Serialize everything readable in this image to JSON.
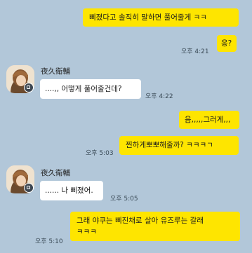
{
  "chat": {
    "messages": [
      {
        "id": "m1",
        "sender": "me",
        "text": "삐졌다고 솔직히 말하면 풀어줄게 ㅋㅋ",
        "time": ""
      },
      {
        "id": "m2",
        "sender": "me",
        "text": "응?",
        "time": "오후 4:21"
      },
      {
        "id": "m3",
        "sender": "other",
        "name": "夜久衛輔",
        "text": "....,, 어떻게 풀어줄건데?",
        "time": "오후 4:22"
      },
      {
        "id": "m4",
        "sender": "me",
        "text": "음,,,,,그러게,,,",
        "time": ""
      },
      {
        "id": "m5",
        "sender": "me",
        "text": "찐하게뽀뽀해줄까? ㅋㅋㅋㄱ",
        "time": "오후 5:03"
      },
      {
        "id": "m6",
        "sender": "other",
        "name": "夜久衛輔",
        "text": "...... 나 삐졌어.",
        "time": "오후 5:05"
      },
      {
        "id": "m7",
        "sender": "me",
        "text_line1": "그래 야쿠는 삐진채로 살아 유즈루는 갈래",
        "text_line2": "ㅋㅋㅋ",
        "time": "오후 5:10"
      }
    ]
  },
  "colors": {
    "background": "#b2c7d9",
    "my_bubble": "#fee500",
    "other_bubble": "#ffffff"
  }
}
